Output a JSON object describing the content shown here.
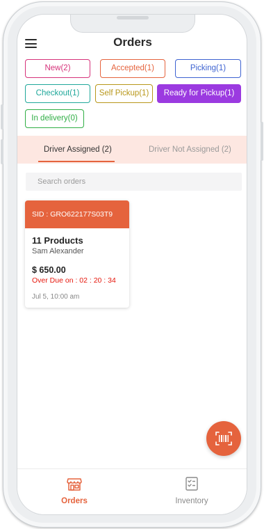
{
  "header": {
    "title": "Orders"
  },
  "icons": {
    "menu": "hamburger-menu-icon",
    "scan": "barcode-scan-icon",
    "orders": "store-icon",
    "inventory": "checklist-icon"
  },
  "colors": {
    "accent": "#e5633d",
    "overdue": "#e6170c",
    "tab_band": "#fde7e1"
  },
  "status_chips": [
    {
      "label": "New(2)",
      "color": "#d6327a"
    },
    {
      "label": "Accepted(1)",
      "color": "#e5633d"
    },
    {
      "label": "Picking(1)",
      "color": "#3d62d1"
    },
    {
      "label": "Checkout(1)",
      "color": "#1fa79a"
    },
    {
      "label": "Self Pickup(1)",
      "color": "#b8971a"
    },
    {
      "label": "Ready for Pickup(1)",
      "color": "#9b3ae0",
      "selected": true
    },
    {
      "label": "In delivery(0)",
      "color": "#2fae44"
    }
  ],
  "tabs": [
    {
      "label": "Driver Assigned (2)",
      "active": true
    },
    {
      "label": "Driver  Not Assigned (2)",
      "active": false
    }
  ],
  "search": {
    "placeholder": "Search orders",
    "value": ""
  },
  "orders": [
    {
      "sid": "SID : GRO622177S03T9",
      "products": "11 Products",
      "customer": "Sam Alexander",
      "amount": "$ 650.00",
      "overdue": "Over Due on : 02 : 20 : 34",
      "date": "Jul 5, 10:00 am"
    }
  ],
  "bottom_nav": [
    {
      "label": "Orders",
      "active": true
    },
    {
      "label": "Inventory",
      "active": false
    }
  ]
}
